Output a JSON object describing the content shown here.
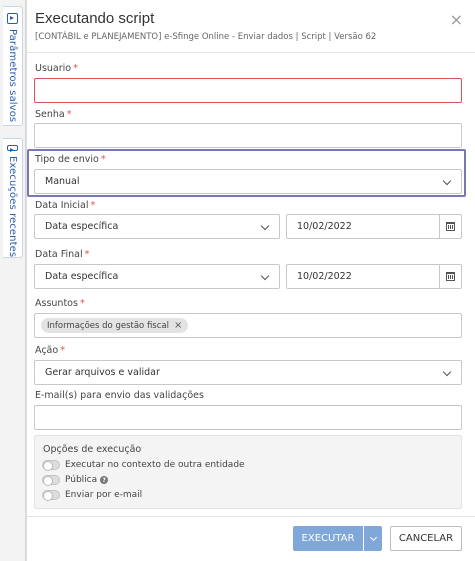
{
  "side_tabs": [
    {
      "label": "Parâmetros salvos"
    },
    {
      "label": "Execuções recentes"
    }
  ],
  "modal": {
    "title": "Executando script",
    "subtitle": "[CONTÁBIL e PLANEJAMENTO] e-Sfinge Online - Enviar dados | Script | Versão 62",
    "close_glyph": "×"
  },
  "form": {
    "usuario": {
      "label": "Usuario",
      "value": "",
      "required": "*"
    },
    "senha": {
      "label": "Senha",
      "value": "",
      "required": "*"
    },
    "tipo_envio": {
      "label": "Tipo de envio",
      "value": "Manual",
      "required": "*"
    },
    "data_inicial": {
      "label": "Data Inicial",
      "select_value": "Data específica",
      "date_value": "10/02/2022",
      "required": "*"
    },
    "data_final": {
      "label": "Data Final",
      "select_value": "Data específica",
      "date_value": "10/02/2022",
      "required": "*"
    },
    "assuntos": {
      "label": "Assuntos",
      "chips": [
        "Informações do gestão fiscal"
      ],
      "chip_remove": "×",
      "required": "*"
    },
    "acao": {
      "label": "Ação",
      "value": "Gerar arquivos e validar",
      "required": "*"
    },
    "emails": {
      "label": "E-mail(s) para envio das validações",
      "value": ""
    }
  },
  "options": {
    "title": "Opções de execução",
    "items": [
      {
        "label": "Executar no contexto de outra entidade",
        "enabled": false
      },
      {
        "label": "Pública",
        "enabled": false,
        "help": "?"
      },
      {
        "label": "Enviar por e-mail",
        "enabled": false
      }
    ]
  },
  "footer": {
    "execute_label": "EXECUTAR",
    "cancel_label": "CANCELAR"
  }
}
